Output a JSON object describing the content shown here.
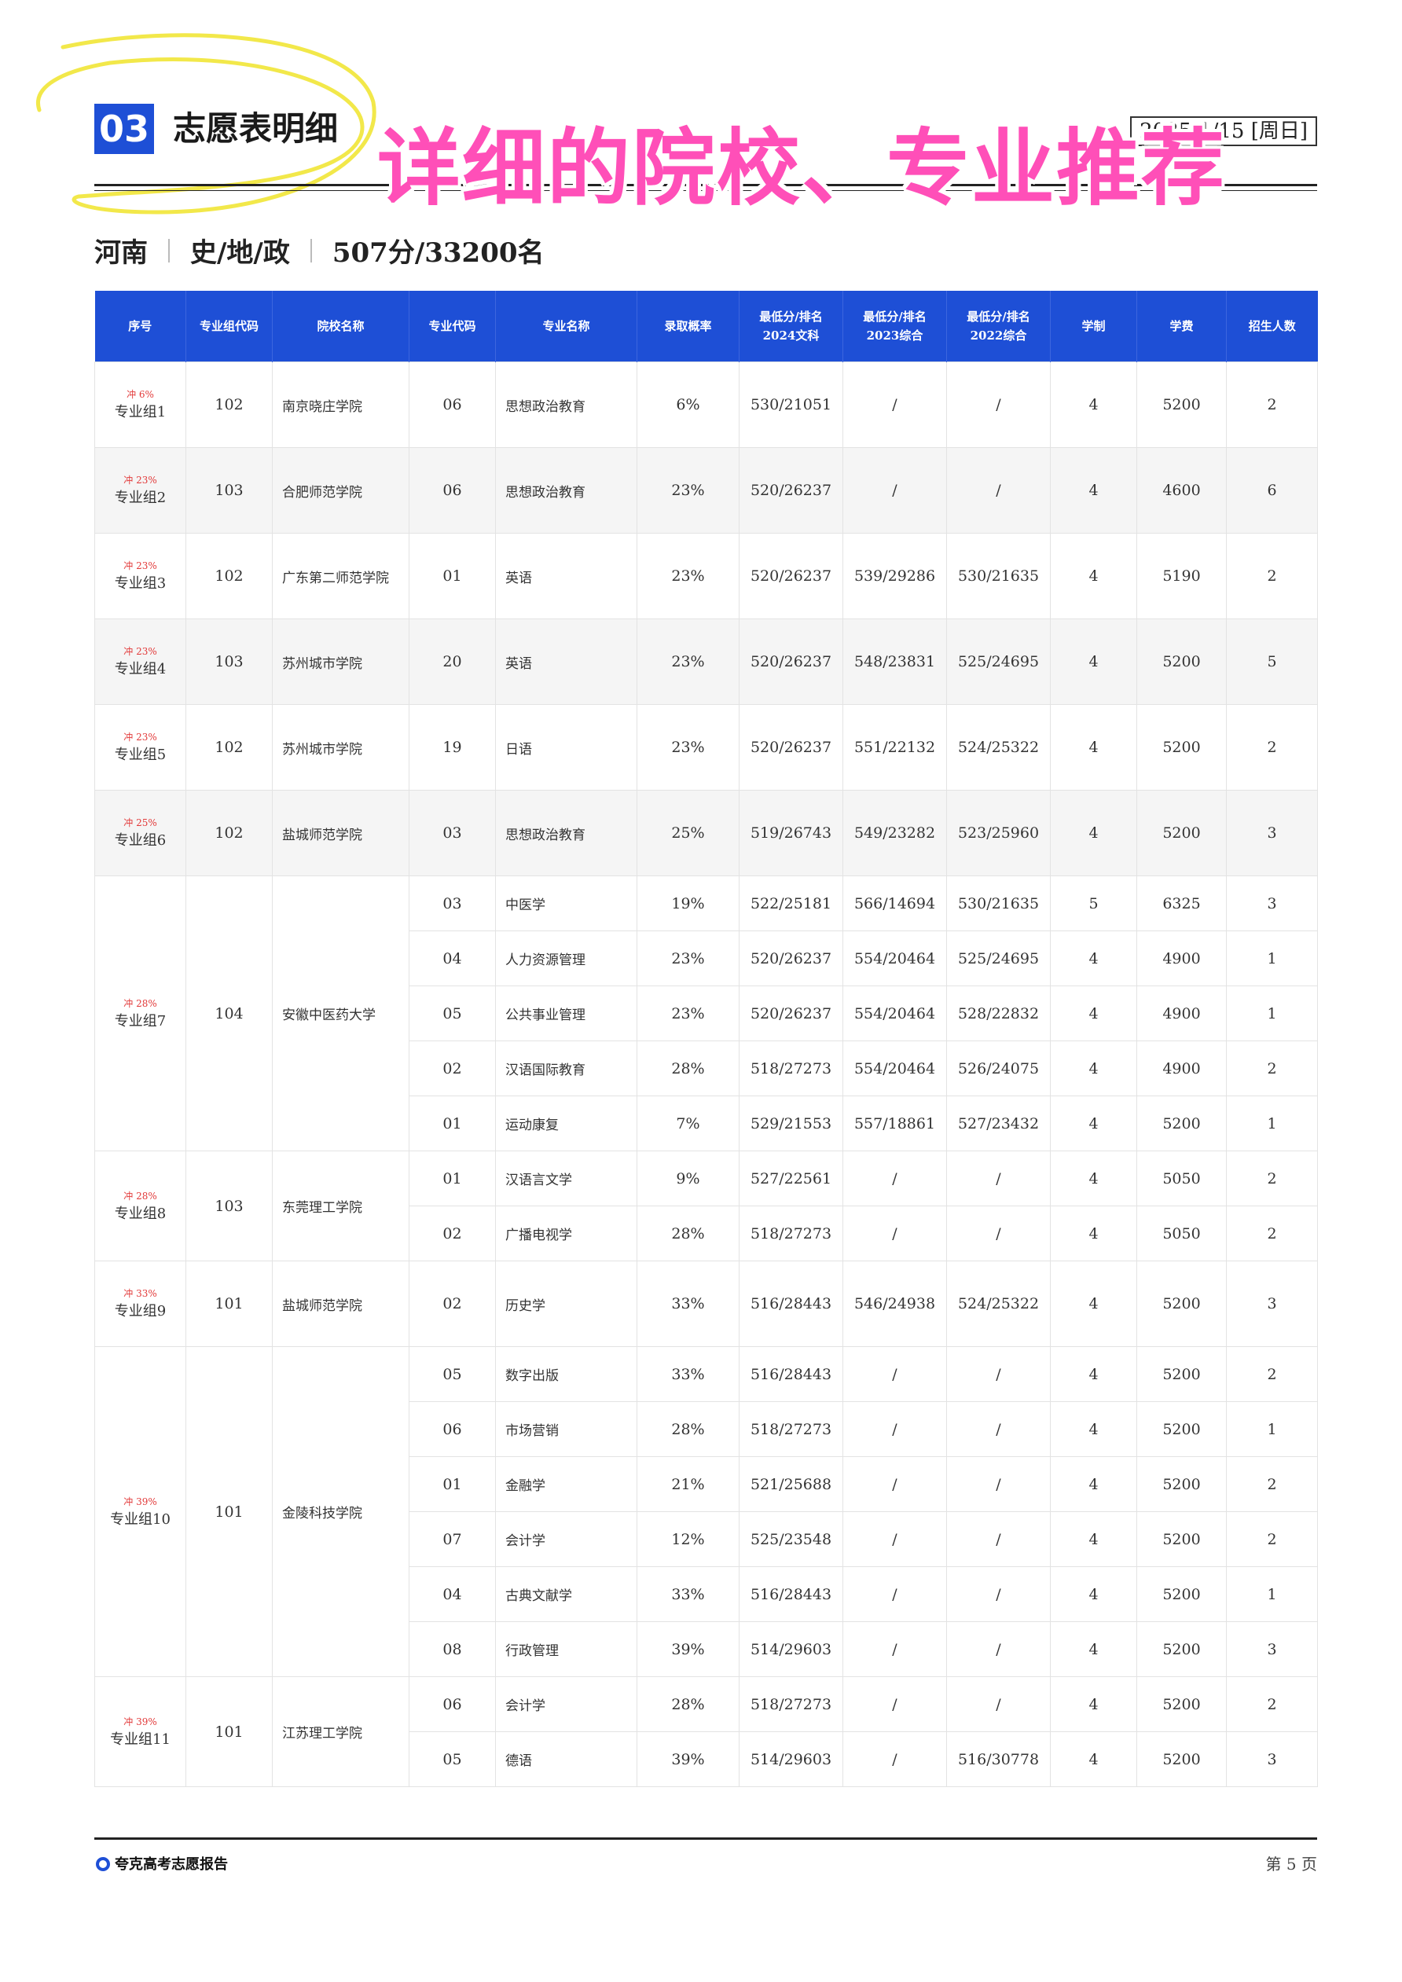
{
  "header": {
    "section_number": "03",
    "section_title": "志愿表明细",
    "date": "2025/1/15 [周日]",
    "overlay_caption": "详细的院校、专业推荐"
  },
  "subheader": {
    "province": "河南",
    "subjects": "史/地/政",
    "score_rank": "507分/33200名"
  },
  "table": {
    "columns": [
      "序号",
      "专业组代码",
      "院校名称",
      "专业代码",
      "专业名称",
      "录取概率",
      "最低分/排名\n2024文科",
      "最低分/排名\n2023综合",
      "最低分/排名\n2022综合",
      "学制",
      "学费",
      "招生人数"
    ],
    "groups": [
      {
        "badge": "冲 6%",
        "label": "专业组1",
        "code": "102",
        "school": "南京晓庄学院",
        "rows": [
          {
            "major_code": "06",
            "major": "思想政治教育",
            "prob": "6%",
            "y2024": "530/21051",
            "y2023": "/",
            "y2022": "/",
            "years": "4",
            "fee": "5200",
            "count": "2"
          }
        ]
      },
      {
        "badge": "冲 23%",
        "label": "专业组2",
        "code": "103",
        "school": "合肥师范学院",
        "rows": [
          {
            "major_code": "06",
            "major": "思想政治教育",
            "prob": "23%",
            "y2024": "520/26237",
            "y2023": "/",
            "y2022": "/",
            "years": "4",
            "fee": "4600",
            "count": "6"
          }
        ]
      },
      {
        "badge": "冲 23%",
        "label": "专业组3",
        "code": "102",
        "school": "广东第二师范学院",
        "rows": [
          {
            "major_code": "01",
            "major": "英语",
            "prob": "23%",
            "y2024": "520/26237",
            "y2023": "539/29286",
            "y2022": "530/21635",
            "years": "4",
            "fee": "5190",
            "count": "2"
          }
        ]
      },
      {
        "badge": "冲 23%",
        "label": "专业组4",
        "code": "103",
        "school": "苏州城市学院",
        "rows": [
          {
            "major_code": "20",
            "major": "英语",
            "prob": "23%",
            "y2024": "520/26237",
            "y2023": "548/23831",
            "y2022": "525/24695",
            "years": "4",
            "fee": "5200",
            "count": "5"
          }
        ]
      },
      {
        "badge": "冲 23%",
        "label": "专业组5",
        "code": "102",
        "school": "苏州城市学院",
        "rows": [
          {
            "major_code": "19",
            "major": "日语",
            "prob": "23%",
            "y2024": "520/26237",
            "y2023": "551/22132",
            "y2022": "524/25322",
            "years": "4",
            "fee": "5200",
            "count": "2"
          }
        ]
      },
      {
        "badge": "冲 25%",
        "label": "专业组6",
        "code": "102",
        "school": "盐城师范学院",
        "rows": [
          {
            "major_code": "03",
            "major": "思想政治教育",
            "prob": "25%",
            "y2024": "519/26743",
            "y2023": "549/23282",
            "y2022": "523/25960",
            "years": "4",
            "fee": "5200",
            "count": "3"
          }
        ]
      },
      {
        "badge": "冲 28%",
        "label": "专业组7",
        "code": "104",
        "school": "安徽中医药大学",
        "rows": [
          {
            "major_code": "03",
            "major": "中医学",
            "prob": "19%",
            "y2024": "522/25181",
            "y2023": "566/14694",
            "y2022": "530/21635",
            "years": "5",
            "fee": "6325",
            "count": "3"
          },
          {
            "major_code": "04",
            "major": "人力资源管理",
            "prob": "23%",
            "y2024": "520/26237",
            "y2023": "554/20464",
            "y2022": "525/24695",
            "years": "4",
            "fee": "4900",
            "count": "1"
          },
          {
            "major_code": "05",
            "major": "公共事业管理",
            "prob": "23%",
            "y2024": "520/26237",
            "y2023": "554/20464",
            "y2022": "528/22832",
            "years": "4",
            "fee": "4900",
            "count": "1"
          },
          {
            "major_code": "02",
            "major": "汉语国际教育",
            "prob": "28%",
            "y2024": "518/27273",
            "y2023": "554/20464",
            "y2022": "526/24075",
            "years": "4",
            "fee": "4900",
            "count": "2"
          },
          {
            "major_code": "01",
            "major": "运动康复",
            "prob": "7%",
            "y2024": "529/21553",
            "y2023": "557/18861",
            "y2022": "527/23432",
            "years": "4",
            "fee": "5200",
            "count": "1"
          }
        ]
      },
      {
        "badge": "冲 28%",
        "label": "专业组8",
        "code": "103",
        "school": "东莞理工学院",
        "rows": [
          {
            "major_code": "01",
            "major": "汉语言文学",
            "prob": "9%",
            "y2024": "527/22561",
            "y2023": "/",
            "y2022": "/",
            "years": "4",
            "fee": "5050",
            "count": "2"
          },
          {
            "major_code": "02",
            "major": "广播电视学",
            "prob": "28%",
            "y2024": "518/27273",
            "y2023": "/",
            "y2022": "/",
            "years": "4",
            "fee": "5050",
            "count": "2"
          }
        ]
      },
      {
        "badge": "冲 33%",
        "label": "专业组9",
        "code": "101",
        "school": "盐城师范学院",
        "rows": [
          {
            "major_code": "02",
            "major": "历史学",
            "prob": "33%",
            "y2024": "516/28443",
            "y2023": "546/24938",
            "y2022": "524/25322",
            "years": "4",
            "fee": "5200",
            "count": "3"
          }
        ]
      },
      {
        "badge": "冲 39%",
        "label": "专业组10",
        "code": "101",
        "school": "金陵科技学院",
        "rows": [
          {
            "major_code": "05",
            "major": "数字出版",
            "prob": "33%",
            "y2024": "516/28443",
            "y2023": "/",
            "y2022": "/",
            "years": "4",
            "fee": "5200",
            "count": "2"
          },
          {
            "major_code": "06",
            "major": "市场营销",
            "prob": "28%",
            "y2024": "518/27273",
            "y2023": "/",
            "y2022": "/",
            "years": "4",
            "fee": "5200",
            "count": "1"
          },
          {
            "major_code": "01",
            "major": "金融学",
            "prob": "21%",
            "y2024": "521/25688",
            "y2023": "/",
            "y2022": "/",
            "years": "4",
            "fee": "5200",
            "count": "2"
          },
          {
            "major_code": "07",
            "major": "会计学",
            "prob": "12%",
            "y2024": "525/23548",
            "y2023": "/",
            "y2022": "/",
            "years": "4",
            "fee": "5200",
            "count": "2"
          },
          {
            "major_code": "04",
            "major": "古典文献学",
            "prob": "33%",
            "y2024": "516/28443",
            "y2023": "/",
            "y2022": "/",
            "years": "4",
            "fee": "5200",
            "count": "1"
          },
          {
            "major_code": "08",
            "major": "行政管理",
            "prob": "39%",
            "y2024": "514/29603",
            "y2023": "/",
            "y2022": "/",
            "years": "4",
            "fee": "5200",
            "count": "3"
          }
        ]
      },
      {
        "badge": "冲 39%",
        "label": "专业组11",
        "code": "101",
        "school": "江苏理工学院",
        "rows": [
          {
            "major_code": "06",
            "major": "会计学",
            "prob": "28%",
            "y2024": "518/27273",
            "y2023": "/",
            "y2022": "/",
            "years": "4",
            "fee": "5200",
            "count": "2"
          },
          {
            "major_code": "05",
            "major": "德语",
            "prob": "39%",
            "y2024": "514/29603",
            "y2023": "/",
            "y2022": "516/30778",
            "years": "4",
            "fee": "5200",
            "count": "3"
          }
        ]
      }
    ]
  },
  "footer": {
    "brand": "夸克高考志愿报告",
    "page": "第 5 页"
  },
  "colors": {
    "accent": "#1e4fd6",
    "badge": "#e23a3a",
    "overlay": "#ff4fb8"
  }
}
